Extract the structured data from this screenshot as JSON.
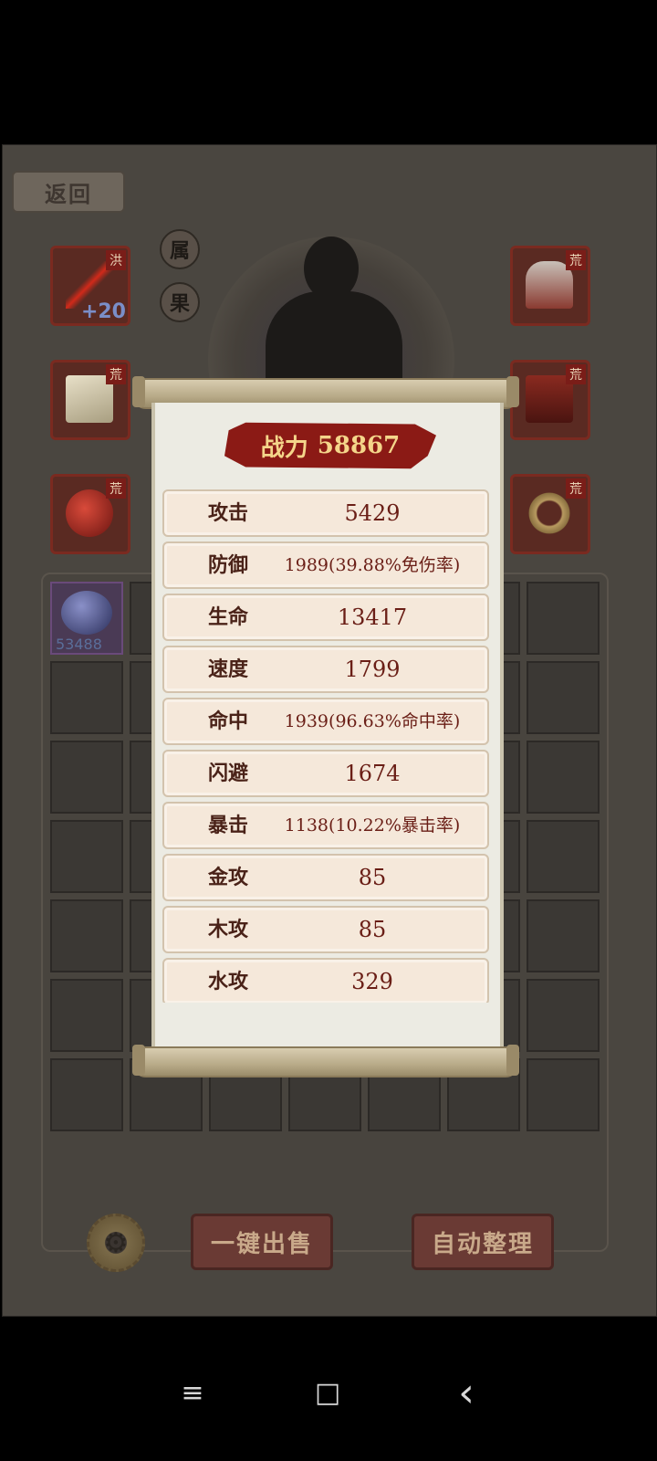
{
  "header": {
    "back_label": "返回"
  },
  "side_buttons": {
    "attr": "属",
    "fruit": "果"
  },
  "equipment": {
    "weapon": {
      "tag": "洪",
      "level": "+20",
      "icon": "red-sword-icon"
    },
    "scroll": {
      "tag": "荒",
      "icon": "scroll-item-icon"
    },
    "orb": {
      "tag": "荒",
      "icon": "red-orb-icon"
    },
    "armor": {
      "tag": "荒",
      "icon": "armor-figure-icon"
    },
    "chest": {
      "tag": "荒",
      "icon": "treasure-box-icon"
    },
    "ring": {
      "tag": "荒",
      "icon": "ring-icon"
    }
  },
  "bag": {
    "first_item_count": "53488",
    "first_item_icon": "blue-gem-icon"
  },
  "actions": {
    "sell_all": "一键出售",
    "auto_sort": "自动整理",
    "settings_icon": "gear-icon"
  },
  "stats_panel": {
    "power_label": "战力",
    "power_value": "58867",
    "rows": [
      {
        "label": "攻击",
        "value": "5429"
      },
      {
        "label": "防御",
        "value": "1989(39.88%免伤率)"
      },
      {
        "label": "生命",
        "value": "13417"
      },
      {
        "label": "速度",
        "value": "1799"
      },
      {
        "label": "命中",
        "value": "1939(96.63%命中率)"
      },
      {
        "label": "闪避",
        "value": "1674"
      },
      {
        "label": "暴击",
        "value": "1138(10.22%暴击率)"
      },
      {
        "label": "金攻",
        "value": "85"
      },
      {
        "label": "木攻",
        "value": "85"
      },
      {
        "label": "水攻",
        "value": "329"
      }
    ]
  },
  "system_nav": {
    "menu_icon": "menu-icon",
    "home_icon": "home-square-icon",
    "back_icon": "back-chevron-icon",
    "menu_glyph": "≡",
    "home_glyph": "□",
    "back_glyph": "‹"
  }
}
